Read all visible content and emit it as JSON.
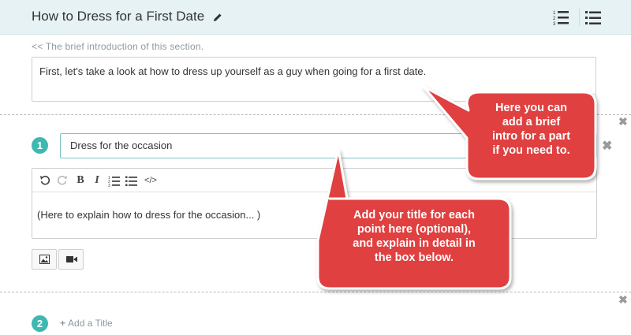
{
  "header": {
    "title": "How to Dress for a First Date"
  },
  "intro": {
    "hint": "<< The brief introduction of this section.",
    "text": "First, let's take a look at how to dress up yourself as a guy when going for a first date."
  },
  "sections": [
    {
      "number": "1",
      "title_value": "Dress for the occasion",
      "body": "(Here to explain how to dress for the occasion... )"
    },
    {
      "number": "2",
      "add_title_label": "Add a Title"
    }
  ],
  "callouts": {
    "intro_tip": [
      "Here you can",
      "add a brief",
      "intro for a part",
      "if you need to."
    ],
    "title_tip": [
      "Add your title for each",
      "point here (optional),",
      "and explain in detail in",
      "the box below."
    ]
  },
  "colors": {
    "accent_teal": "#3fb8b2",
    "callout_red": "#e0403f",
    "header_bg": "#e6f2f3"
  }
}
